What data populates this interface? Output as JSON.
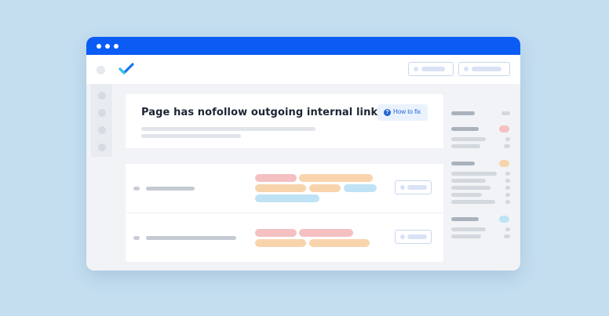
{
  "issue": {
    "title": "Page has nofollow outgoing internal links",
    "how_to_fix_label": "How to fix",
    "help_icon_glyph": "?"
  },
  "colors": {
    "background": "#c4def0",
    "titlebar": "#0a5cf5",
    "accent": "#1e63d6",
    "tag_pink": "#f4c0c2",
    "tag_peach": "#f8d4ad",
    "tag_blue": "#bfe3f4"
  },
  "icons": {
    "logo": "checkmark-logo-icon",
    "help": "question-circle-icon"
  }
}
